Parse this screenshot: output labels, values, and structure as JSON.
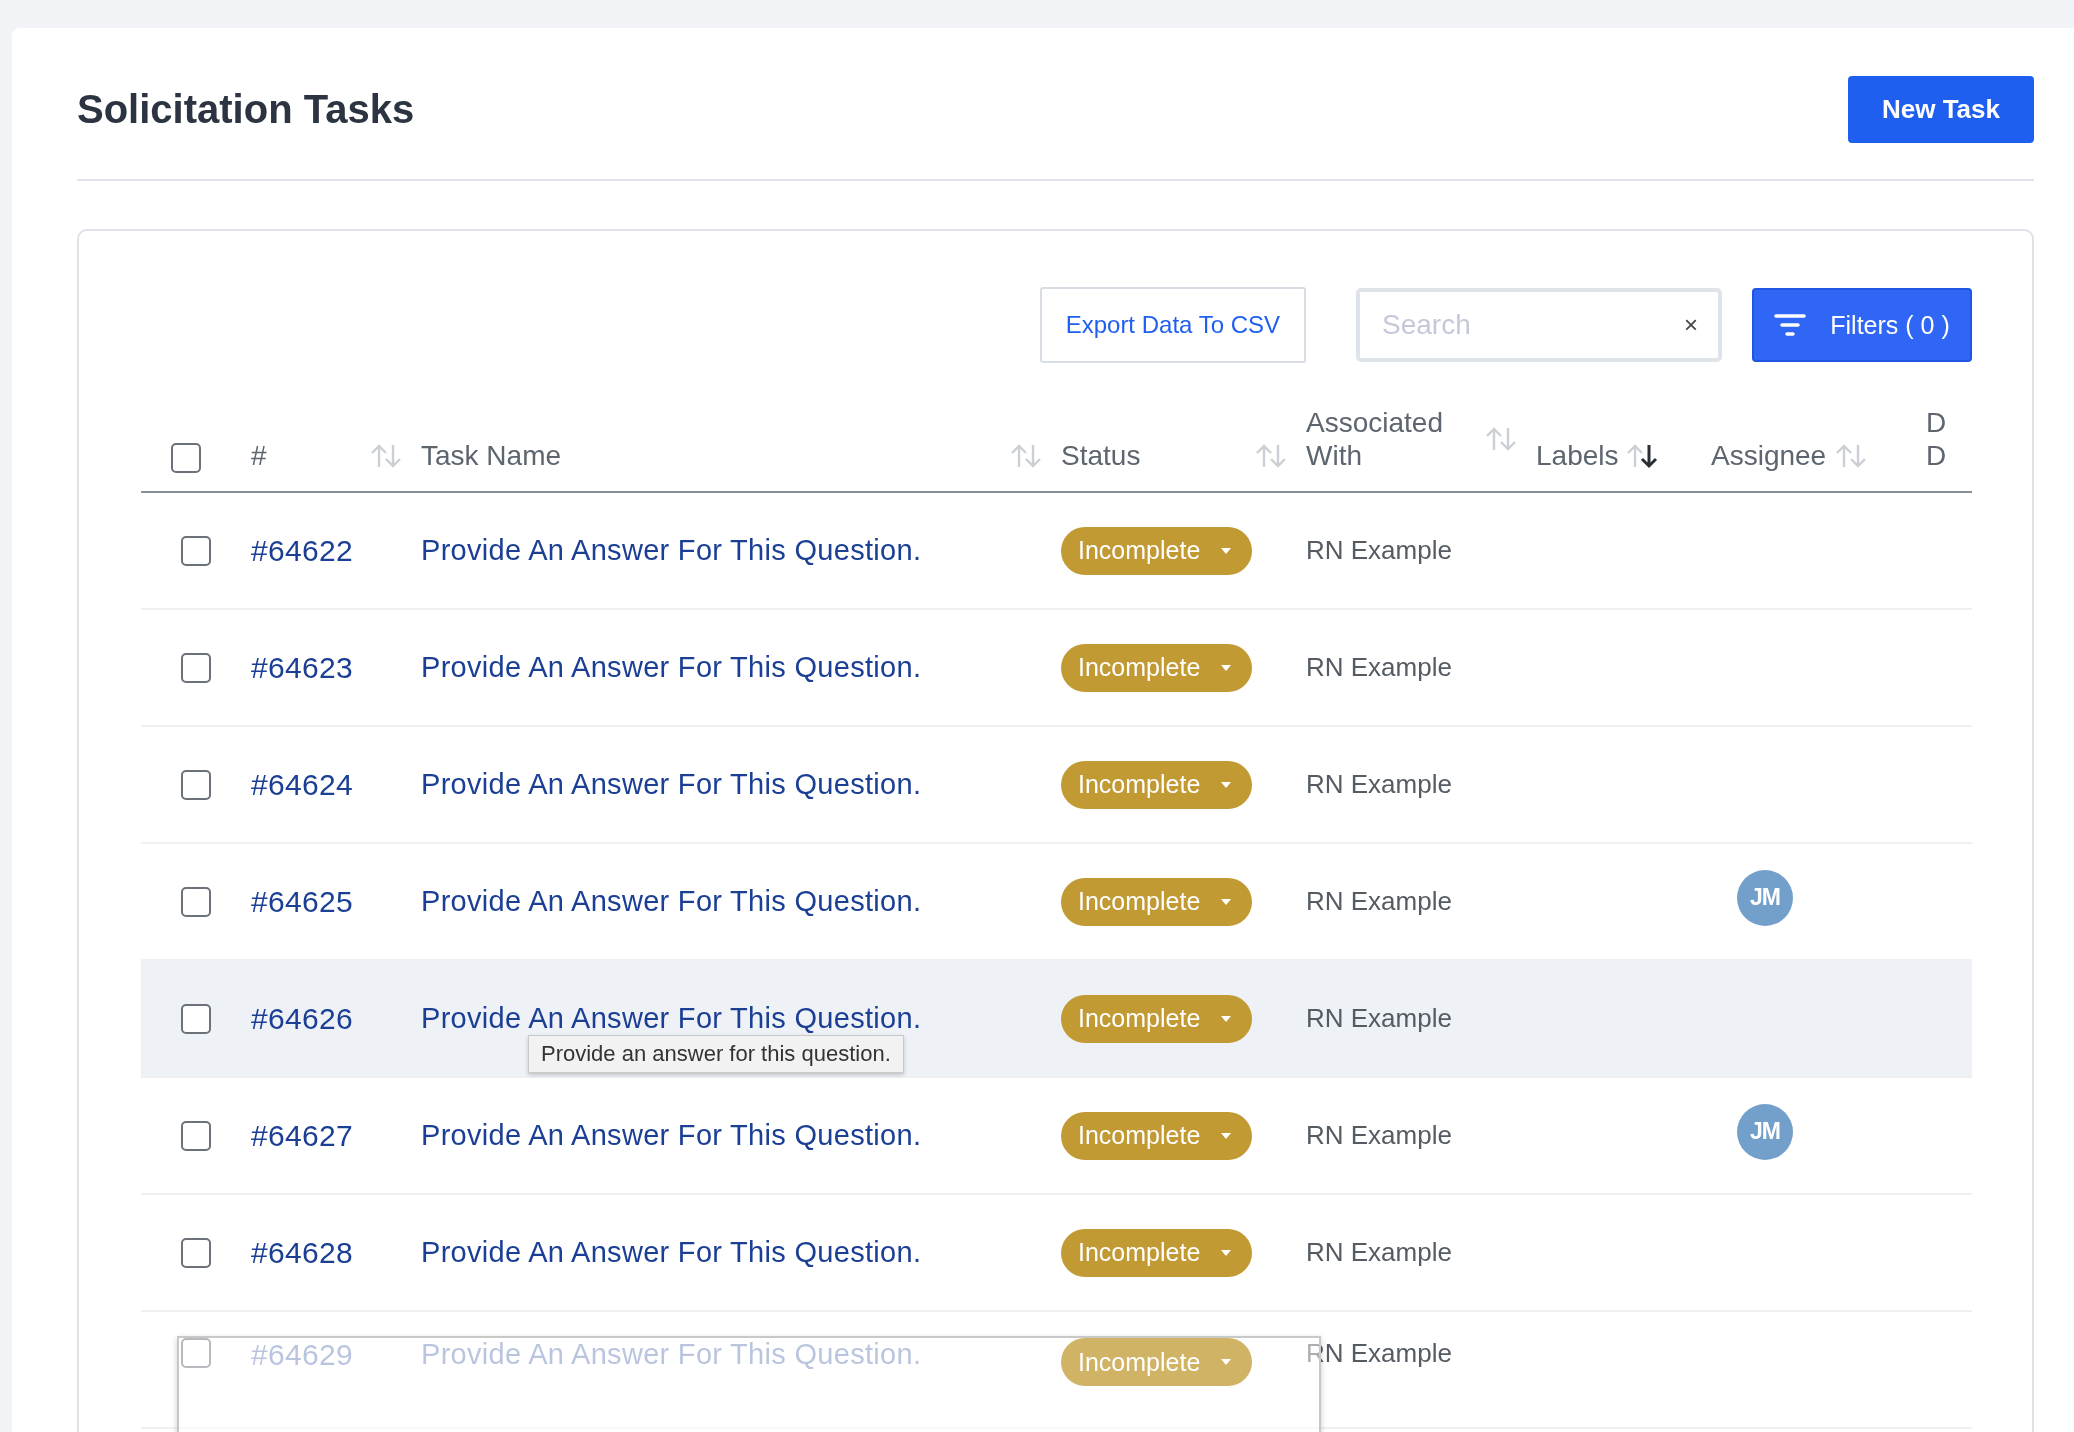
{
  "page": {
    "title": "Solicitation Tasks",
    "new_button": "New Task"
  },
  "toolbar": {
    "export_button": "Export Data To CSV",
    "search": {
      "placeholder": "Search",
      "clear": "×"
    },
    "filters_button": "Filters ( 0 )"
  },
  "table": {
    "select_all": {
      "checked": false
    },
    "columns": [
      {
        "label": "#",
        "sorted": false
      },
      {
        "label": "Task Name",
        "sorted": false
      },
      {
        "label": "Status",
        "sorted": false
      },
      {
        "label": "Associated With",
        "sorted": false
      },
      {
        "label": "Labels",
        "sorted": true
      },
      {
        "label": "Assignee",
        "sorted": false
      },
      {
        "label": "D D"
      }
    ],
    "rows": [
      {
        "id": "#64622",
        "task": "Provide An Answer For This Question.",
        "status": "Incomplete",
        "associated": "RN Example",
        "checked": false,
        "hovered": false,
        "dragging": false
      },
      {
        "id": "#64623",
        "task": "Provide An Answer For This Question.",
        "status": "Incomplete",
        "associated": "RN Example",
        "checked": false,
        "hovered": false,
        "dragging": false
      },
      {
        "id": "#64624",
        "task": "Provide An Answer For This Question.",
        "status": "Incomplete",
        "associated": "RN Example",
        "checked": false,
        "hovered": false,
        "dragging": false
      },
      {
        "id": "#64625",
        "task": "Provide An Answer For This Question.",
        "status": "Incomplete",
        "associated": "RN Example",
        "assignee": "JM",
        "checked": false,
        "hovered": false,
        "dragging": false
      },
      {
        "id": "#64626",
        "task": "Provide An Answer For This Question.",
        "status": "Incomplete",
        "associated": "RN Example",
        "checked": false,
        "hovered": true,
        "dragging": false,
        "tooltip": "Provide an answer for this question."
      },
      {
        "id": "#64627",
        "task": "Provide An Answer For This Question.",
        "status": "Incomplete",
        "associated": "RN Example",
        "assignee": "JM",
        "checked": false,
        "hovered": false,
        "dragging": false
      },
      {
        "id": "#64628",
        "task": "Provide An Answer For This Question.",
        "status": "Incomplete",
        "associated": "RN Example",
        "checked": false,
        "hovered": false,
        "dragging": false
      },
      {
        "id": "#64629",
        "task": "Provide An Answer For This Question.",
        "status": "Incomplete",
        "associated": "RN Example",
        "checked": false,
        "hovered": false,
        "dragging": true
      }
    ]
  }
}
